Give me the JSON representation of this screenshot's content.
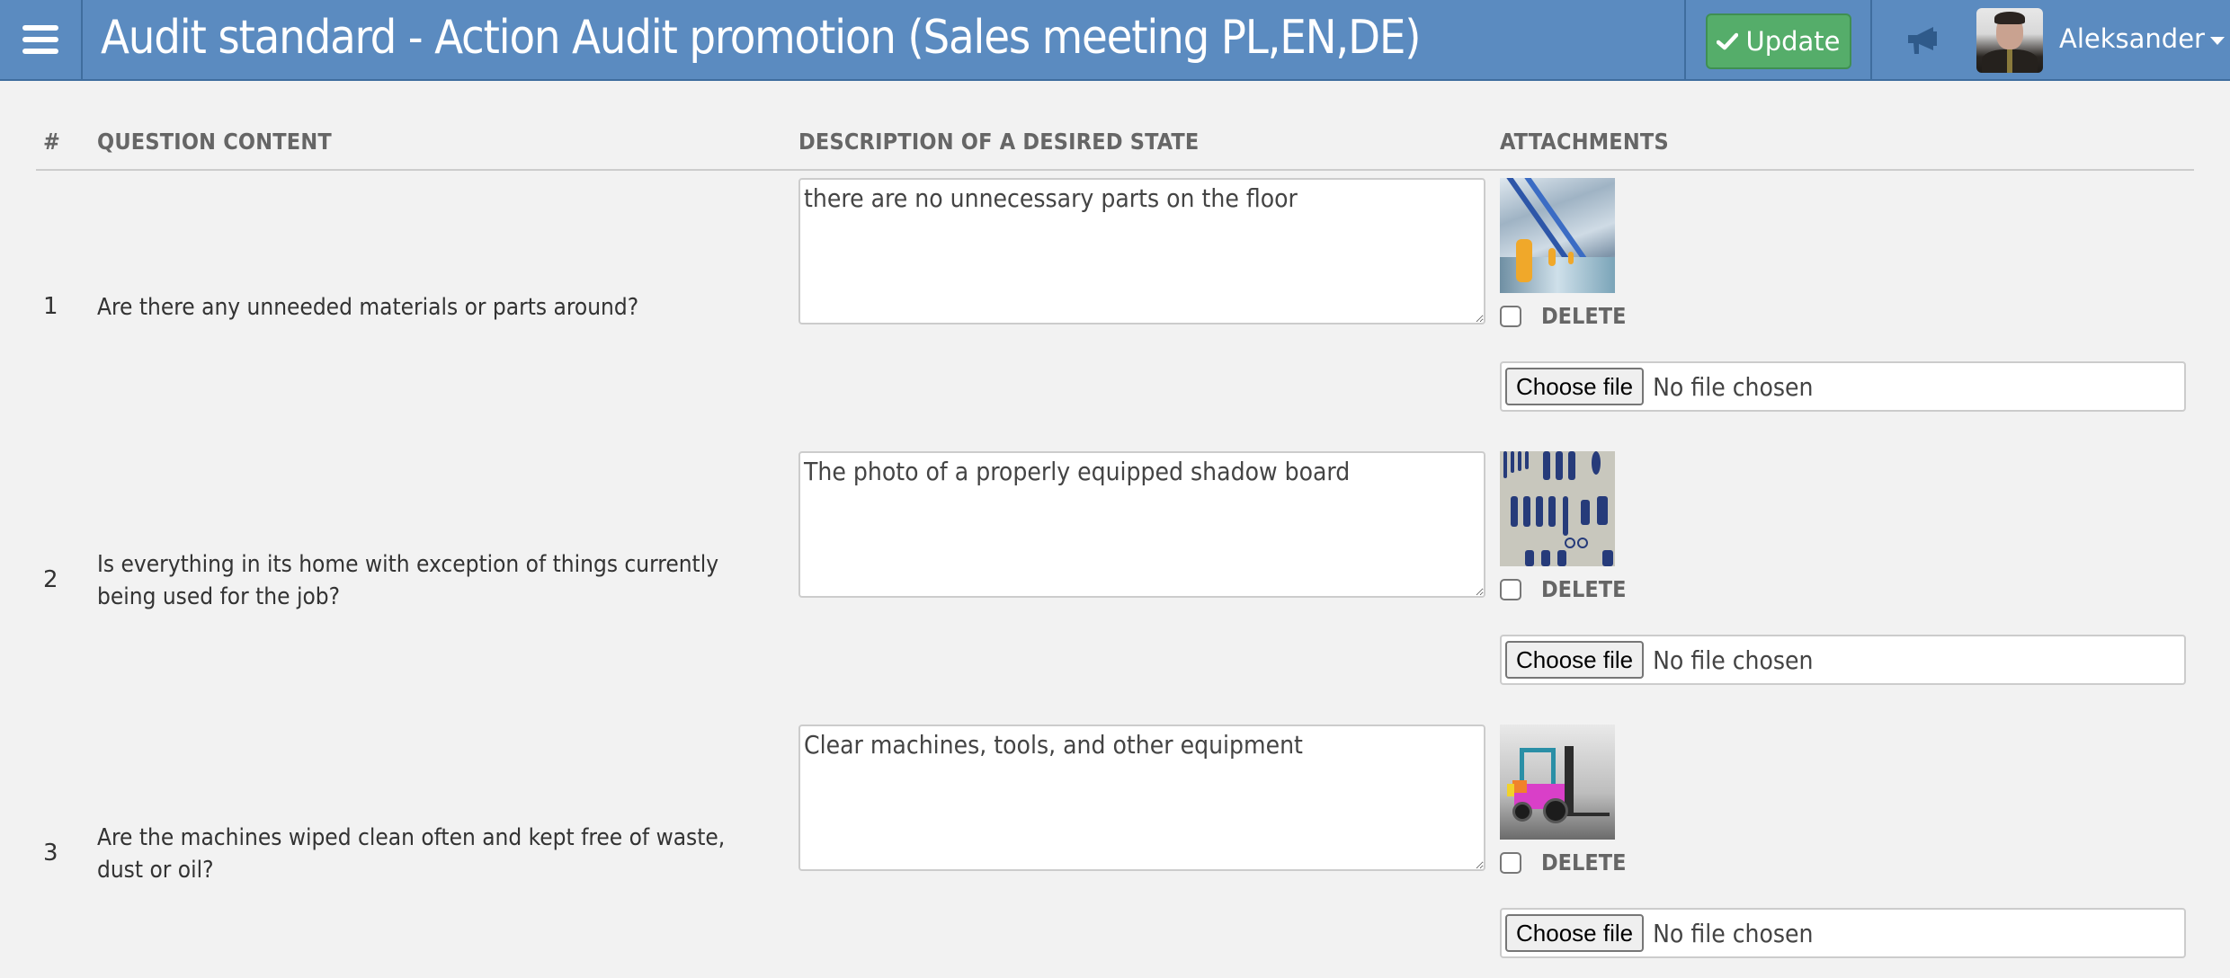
{
  "header": {
    "title": "Audit standard - Action Audit promotion (Sales meeting PL,EN,DE)",
    "menu_icon": "hamburger-menu-icon",
    "update_label": "Update",
    "update_icon": "check-icon",
    "notifications_icon": "megaphone-icon",
    "user_name": "Aleksander",
    "colors": {
      "bar": "#5b8bc0",
      "update_button": "#55ad6a"
    }
  },
  "table": {
    "columns": [
      "#",
      "QUESTION CONTENT",
      "DESCRIPTION OF A DESIRED STATE",
      "ATTACHMENTS"
    ],
    "delete_label": "DELETE",
    "choose_file_label": "Choose file",
    "no_file_label": "No file chosen",
    "rows": [
      {
        "num": "1",
        "question": "Are there any unneeded materials or parts around?",
        "description": "there are no unnecessary parts on the floor",
        "attachment": "factory-interior-photo",
        "delete_checked": false
      },
      {
        "num": "2",
        "question": "Is everything in its home with exception of things currently being used for the job?",
        "description": "The photo of a properly equipped shadow board",
        "attachment": "shadow-board-tools-photo",
        "delete_checked": false
      },
      {
        "num": "3",
        "question": "Are the machines wiped clean often and kept free of waste, dust or oil?",
        "description": "Clear machines, tools, and other equipment",
        "attachment": "forklift-photo",
        "delete_checked": false
      }
    ]
  }
}
